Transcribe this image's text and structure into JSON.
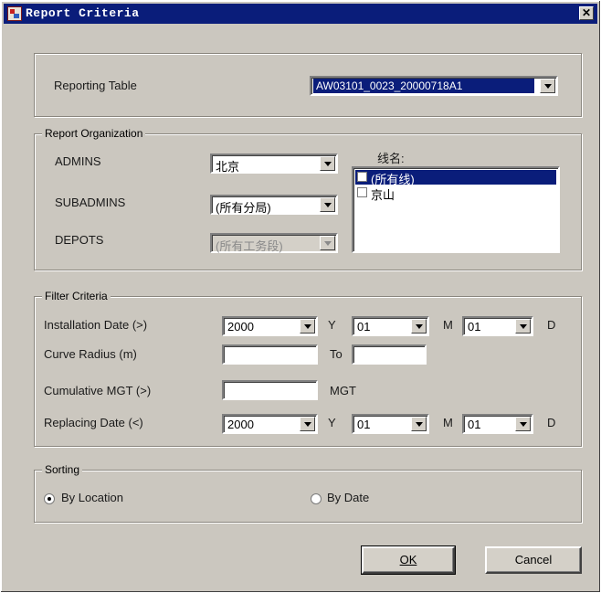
{
  "window": {
    "title": "Report Criteria",
    "close_glyph": "✕"
  },
  "reporting": {
    "label": "Reporting Table",
    "value": "AW03101_0023_20000718A1"
  },
  "organization": {
    "group_title": "Report Organization",
    "admins_label": "ADMINS",
    "admins_value": "北京",
    "subadmins_label": "SUBADMINS",
    "subadmins_value": "(所有分局)",
    "depots_label": "DEPOTS",
    "depots_value": "(所有工务段)",
    "line_label": "线名:",
    "lines": [
      {
        "label": "(所有线)",
        "selected": true
      },
      {
        "label": "京山",
        "selected": false
      }
    ]
  },
  "filter": {
    "group_title": "Filter Criteria",
    "installation_label": "Installation Date (>)",
    "installation_year": "2000",
    "installation_month": "01",
    "installation_day": "01",
    "curve_label": "Curve Radius (m)",
    "curve_from": "",
    "curve_to_label": "To",
    "curve_to": "",
    "mgt_label": "Cumulative MGT (>)",
    "mgt_value": "",
    "mgt_unit": "MGT",
    "replacing_label": "Replacing Date (<)",
    "replacing_year": "2000",
    "replacing_month": "01",
    "replacing_day": "01",
    "y": "Y",
    "m": "M",
    "d": "D"
  },
  "sorting": {
    "group_title": "Sorting",
    "by_location": "By Location",
    "by_date": "By Date",
    "selected": "By Location"
  },
  "buttons": {
    "ok": "OK",
    "cancel": "Cancel"
  }
}
